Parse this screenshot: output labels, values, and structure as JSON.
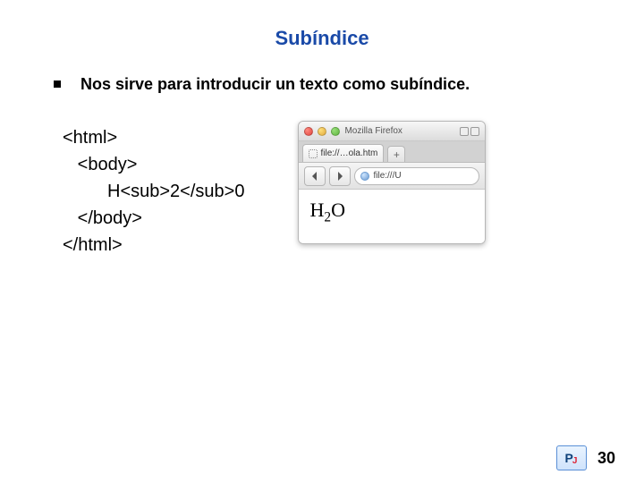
{
  "title": "Subíndice",
  "bullet": "Nos sirve para introducir un texto como subíndice.",
  "code": "<html>\n   <body>\n         H<sub>2</sub>0\n   </body>\n</html>",
  "browser": {
    "app_name": "Mozilla Firefox",
    "tab_label": "file://…ola.htm",
    "tab_plus": "+",
    "url": "file:///U",
    "rendered_main": "H",
    "rendered_sub": "2",
    "rendered_tail": "O"
  },
  "page_number": "30"
}
